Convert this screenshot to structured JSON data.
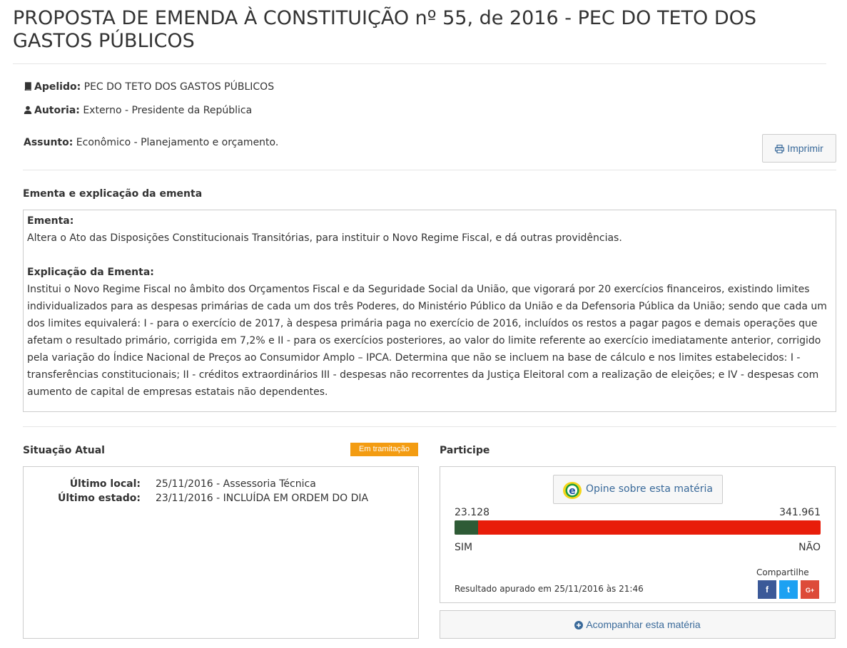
{
  "page": {
    "title": "PROPOSTA DE EMENDA À CONSTITUIÇÃO nº 55, de 2016 - PEC DO TETO DOS GASTOS PÚBLICOS"
  },
  "meta": {
    "apelido_label": "Apelido:",
    "apelido_value": "PEC DO TETO DOS GASTOS PÚBLICOS",
    "autoria_label": "Autoria:",
    "autoria_value": "Externo - Presidente da República",
    "assunto_label": "Assunto:",
    "assunto_value": "Econômico - Planejamento e orçamento.",
    "print_label": "Imprimir",
    "icons": {
      "apelido": "book-icon",
      "autoria": "user-icon",
      "print": "print-icon"
    }
  },
  "ementa": {
    "section_title": "Ementa e explicação da ementa",
    "ementa_label": "Ementa:",
    "ementa_text": "Altera o Ato das Disposições Constitucionais Transitórias, para instituir o Novo Regime Fiscal, e dá outras providências.",
    "explicacao_label": "Explicação da Ementa:",
    "explicacao_text": "Institui o Novo Regime Fiscal no âmbito dos Orçamentos Fiscal e da Seguridade Social da União, que vigorará por 20 exercícios financeiros, existindo limites individualizados para as despesas primárias de cada um dos três Poderes, do Ministério Público da União e da Defensoria Pública da União; sendo que cada um dos limites equivalerá: I - para o exercício de 2017, à despesa primária paga no exercício de 2016, incluídos os restos a pagar pagos e demais operações que afetam o resultado primário, corrigida em 7,2% e II - para os exercícios posteriores, ao valor do limite referente ao exercício imediatamente anterior, corrigido pela variação do Índice Nacional de Preços ao Consumidor Amplo – IPCA. Determina que não se incluem na base de cálculo e nos limites estabelecidos: I - transferências constitucionais; II - créditos extraordinários III - despesas não recorrentes da Justiça Eleitoral com a realização de eleições; e IV - despesas com aumento de capital de empresas estatais não dependentes."
  },
  "situacao": {
    "title": "Situação Atual",
    "badge": "Em tramitação",
    "badge_color": "#f39c12",
    "ultimo_local_label": "Último local:",
    "ultimo_local_value": "25/11/2016 - Assessoria Técnica",
    "ultimo_estado_label": "Último estado:",
    "ultimo_estado_value": "23/11/2016 - INCLUÍDA EM ORDEM DO DIA"
  },
  "participe": {
    "title": "Participe",
    "opine_label": "Opine sobre esta matéria",
    "sim_count": "23.128",
    "nao_count": "341.961",
    "sim_fraction": 0.0634,
    "sim_label": "SIM",
    "nao_label": "NÃO",
    "sim_color": "#2e5b36",
    "nao_color": "#e81d0a",
    "result_text": "Resultado apurado em 25/11/2016 às 21:46",
    "share_label": "Compartilhe",
    "share": [
      {
        "name": "facebook",
        "glyph": "f",
        "color": "#3b5998"
      },
      {
        "name": "twitter",
        "glyph": "t",
        "color": "#1da1f2"
      },
      {
        "name": "google-plus",
        "glyph": "G+",
        "color": "#dd4b39"
      }
    ],
    "follow_label": "Acompanhar esta matéria"
  }
}
